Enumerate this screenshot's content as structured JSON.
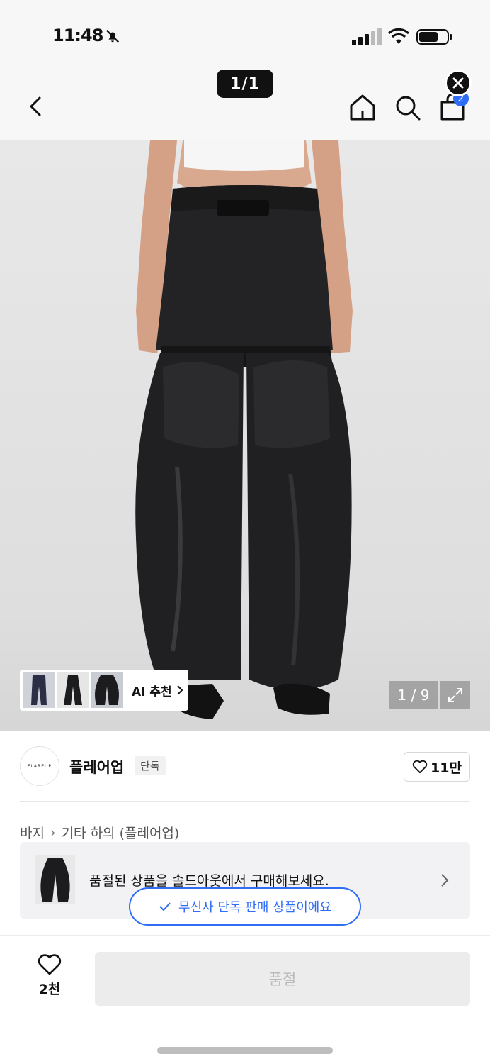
{
  "status": {
    "time": "11:48"
  },
  "header": {
    "page_indicator": "1/1",
    "cart_count": "2"
  },
  "product": {
    "ai_recommend_label": "AI 추천",
    "image_counter": "1 / 9",
    "brand_logo_text": "FLAREUP",
    "brand_name": "플레어업",
    "brand_tag": "단독",
    "like_count": "11만",
    "breadcrumb": [
      "바지",
      "기타 하의 (플레어업)"
    ],
    "soldout_banner_text": "품절된 상품을 솔드아웃에서 구매해보세요.",
    "exclusive_label": "무신사 단독 판매 상품이에요"
  },
  "bottom": {
    "wish_count": "2천",
    "buy_label": "품절"
  },
  "colors": {
    "accent": "#2f6df6",
    "pants": "#1c1c1e",
    "disabled_bg": "#ececec"
  },
  "icons": [
    "bell-off-icon",
    "signal-icon",
    "wifi-icon",
    "battery-icon",
    "back-icon",
    "home-icon",
    "search-icon",
    "cart-icon",
    "close-icon",
    "chevron-right-icon",
    "expand-icon",
    "heart-icon",
    "check-icon"
  ]
}
